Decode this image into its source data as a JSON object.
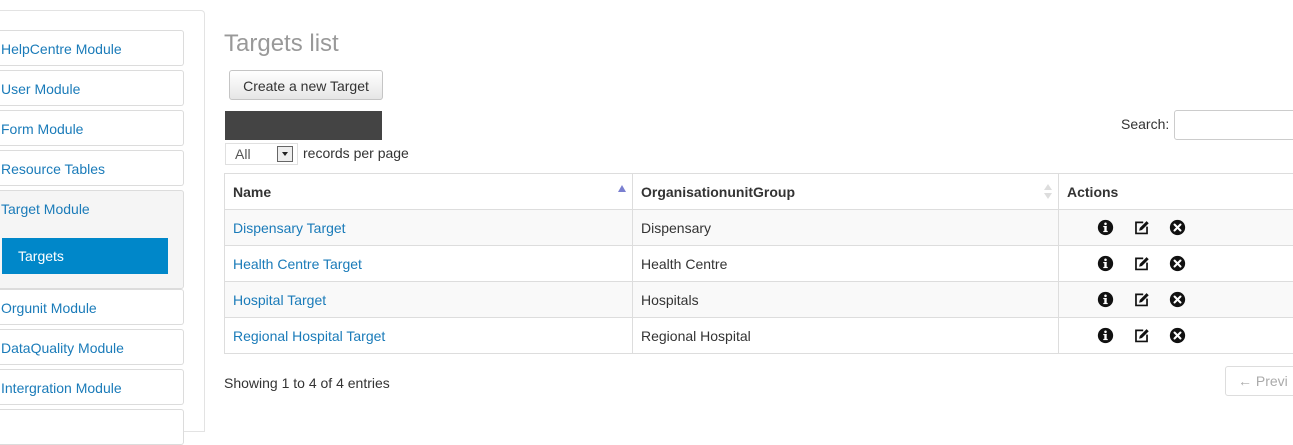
{
  "sidebar": {
    "items": [
      {
        "label": "HelpCentre Module"
      },
      {
        "label": "User Module"
      },
      {
        "label": "Form Module"
      },
      {
        "label": "Resource Tables"
      },
      {
        "label": "Target Module",
        "sub": "Targets"
      },
      {
        "label": "Orgunit Module"
      },
      {
        "label": "DataQuality Module"
      },
      {
        "label": "Intergration Module"
      }
    ]
  },
  "main": {
    "title": "Targets list",
    "create_button": "Create a new Target",
    "length_select": "All",
    "length_text": "records per page",
    "search_label": "Search:",
    "search_value": "",
    "table": {
      "headers": [
        "Name",
        "OrganisationunitGroup",
        "Actions"
      ],
      "sorted_column": "Name",
      "sort_direction": "ascending",
      "rows": [
        {
          "name": "Dispensary Target",
          "group": "Dispensary"
        },
        {
          "name": "Health Centre Target",
          "group": "Health Centre"
        },
        {
          "name": "Hospital Target",
          "group": "Hospitals"
        },
        {
          "name": "Regional Hospital Target",
          "group": "Regional Hospital"
        }
      ],
      "action_icons": [
        "info-icon",
        "edit-icon",
        "delete-icon"
      ]
    },
    "info": "Showing 1 to 4 of 4 entries",
    "prev_button": "← Previ"
  },
  "colors": {
    "link": "#1a7bb9",
    "active_sub": "#0087c9",
    "title": "#999999"
  }
}
